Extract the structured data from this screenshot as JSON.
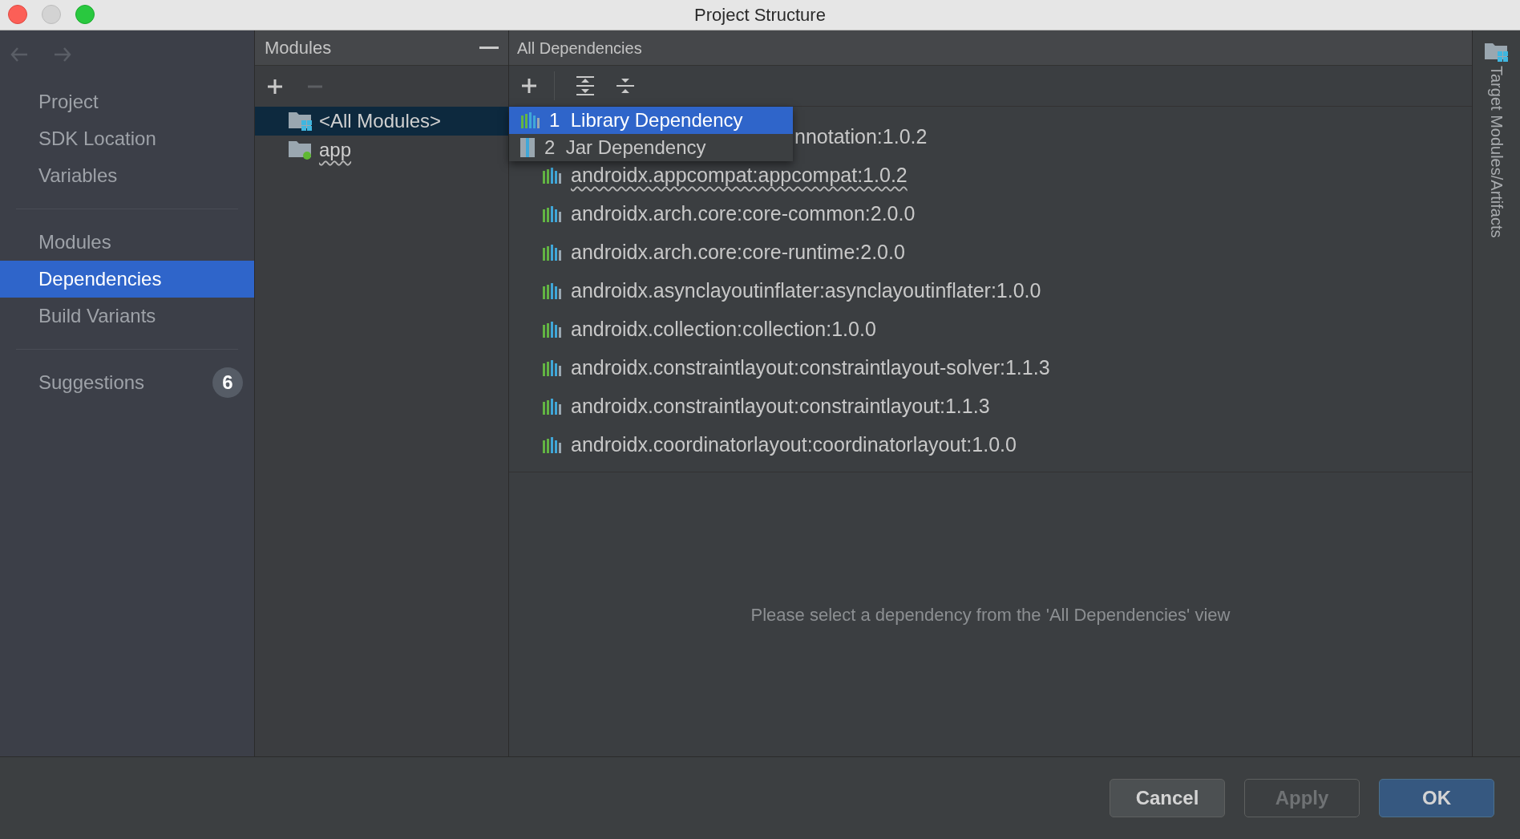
{
  "window": {
    "title": "Project Structure"
  },
  "nav": [
    {
      "kind": "back",
      "disabled": true
    },
    {
      "kind": "forward",
      "disabled": true
    }
  ],
  "sidebar": {
    "sections": [
      {
        "items": [
          {
            "label": "Project",
            "selected": false
          },
          {
            "label": "SDK Location",
            "selected": false
          },
          {
            "label": "Variables",
            "selected": false
          }
        ]
      },
      {
        "items": [
          {
            "label": "Modules",
            "selected": false
          },
          {
            "label": "Dependencies",
            "selected": true
          },
          {
            "label": "Build Variants",
            "selected": false
          }
        ]
      },
      {
        "items": [
          {
            "label": "Suggestions",
            "selected": false,
            "badge": "6"
          }
        ]
      }
    ]
  },
  "modules_panel": {
    "title": "Modules",
    "toolbar": [
      {
        "kind": "add",
        "disabled": false
      },
      {
        "kind": "remove",
        "disabled": true
      }
    ],
    "items": [
      {
        "label": "<All Modules>",
        "kind": "all",
        "selected": true,
        "warning": false
      },
      {
        "label": "app",
        "kind": "module",
        "selected": false,
        "warning": true
      }
    ]
  },
  "dependencies_panel": {
    "title": "All Dependencies",
    "toolbar": [
      {
        "kind": "add"
      },
      {
        "kind": "expand"
      },
      {
        "kind": "collapse"
      }
    ],
    "popup": [
      {
        "number": "1",
        "label": "Library Dependency",
        "kind": "library",
        "selected": true
      },
      {
        "number": "2",
        "label": "Jar Dependency",
        "kind": "jar",
        "selected": false
      }
    ],
    "rows": [
      {
        "text": "nnotation:1.0.2",
        "kind": "partial",
        "warning": false
      },
      {
        "text": "androidx.appcompat:appcompat:1.0.2",
        "kind": "library",
        "warning": true
      },
      {
        "text": "androidx.arch.core:core-common:2.0.0",
        "kind": "library",
        "warning": false
      },
      {
        "text": "androidx.arch.core:core-runtime:2.0.0",
        "kind": "library",
        "warning": false
      },
      {
        "text": "androidx.asynclayoutinflater:asynclayoutinflater:1.0.0",
        "kind": "library",
        "warning": false
      },
      {
        "text": "androidx.collection:collection:1.0.0",
        "kind": "library",
        "warning": false
      },
      {
        "text": "androidx.constraintlayout:constraintlayout-solver:1.1.3",
        "kind": "library",
        "warning": false
      },
      {
        "text": "androidx.constraintlayout:constraintlayout:1.1.3",
        "kind": "library",
        "warning": false
      },
      {
        "text": "androidx.coordinatorlayout:coordinatorlayout:1.0.0",
        "kind": "library",
        "warning": false
      }
    ],
    "message": "Please select a dependency from the 'All Dependencies' view"
  },
  "side_strip": {
    "label": "Target Modules/Artifacts"
  },
  "buttons": [
    {
      "label": "Cancel",
      "kind": "default"
    },
    {
      "label": "Apply",
      "kind": "disabled"
    },
    {
      "label": "OK",
      "kind": "primary"
    }
  ]
}
